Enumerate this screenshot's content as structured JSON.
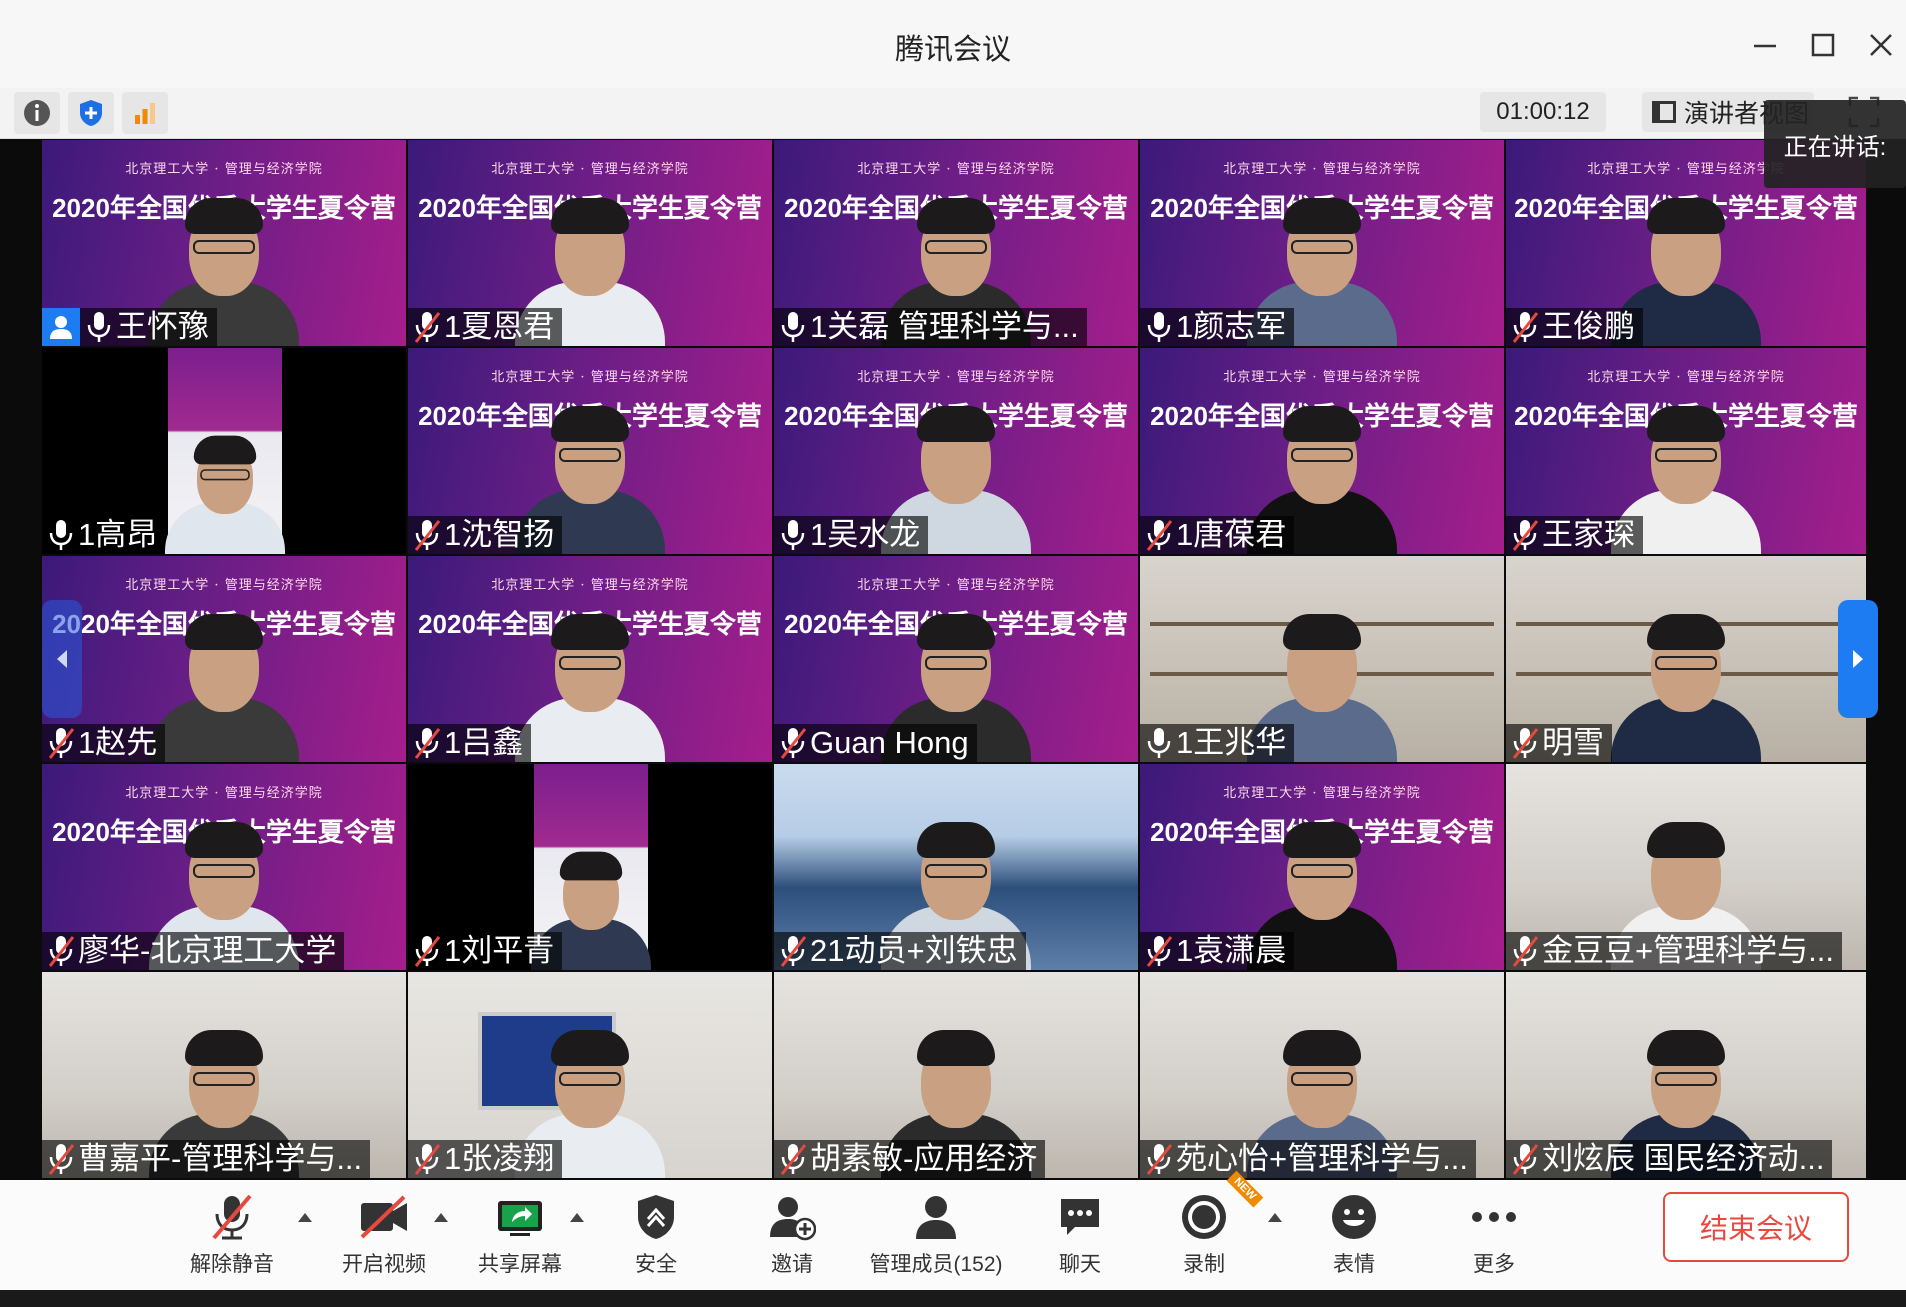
{
  "window": {
    "title": "腾讯会议"
  },
  "toolbar": {
    "timer": "01:00:12",
    "speaker_view": "演讲者视图",
    "speaking_label": "正在讲话:"
  },
  "participants": [
    {
      "name": "王怀豫",
      "mic": "on",
      "bg": "banner",
      "host": true
    },
    {
      "name": "1夏恩君",
      "mic": "muted",
      "bg": "banner"
    },
    {
      "name": "1关磊 管理科学与...",
      "mic": "on",
      "bg": "banner"
    },
    {
      "name": "1颜志军",
      "mic": "on",
      "bg": "banner"
    },
    {
      "name": "王俊鹏",
      "mic": "muted",
      "bg": "banner"
    },
    {
      "name": "1高昂",
      "mic": "on",
      "bg": "narrow"
    },
    {
      "name": "1沈智扬",
      "mic": "muted",
      "bg": "banner"
    },
    {
      "name": "1吴水龙",
      "mic": "on",
      "bg": "banner"
    },
    {
      "name": "1唐葆君",
      "mic": "muted",
      "bg": "banner"
    },
    {
      "name": "王家琛",
      "mic": "muted",
      "bg": "banner"
    },
    {
      "name": "1赵先",
      "mic": "muted",
      "bg": "banner"
    },
    {
      "name": "1吕鑫",
      "mic": "muted",
      "bg": "banner"
    },
    {
      "name": "Guan Hong",
      "mic": "muted",
      "bg": "banner"
    },
    {
      "name": "1王兆华",
      "mic": "on",
      "bg": "shelf"
    },
    {
      "name": "明雪",
      "mic": "muted",
      "bg": "shelf"
    },
    {
      "name": "廖华-北京理工大学",
      "mic": "muted",
      "bg": "banner"
    },
    {
      "name": "1刘平青",
      "mic": "muted",
      "bg": "narrow"
    },
    {
      "name": "21动员+刘铁忠",
      "mic": "muted",
      "bg": "sky"
    },
    {
      "name": "1袁潇晨",
      "mic": "muted",
      "bg": "banner"
    },
    {
      "name": "金豆豆+管理科学与...",
      "mic": "muted",
      "bg": "room"
    },
    {
      "name": "曹嘉平-管理科学与...",
      "mic": "muted",
      "bg": "room"
    },
    {
      "name": "1张凌翔",
      "mic": "muted",
      "bg": "office"
    },
    {
      "name": "胡素敏-应用经济",
      "mic": "muted",
      "bg": "room"
    },
    {
      "name": "苑心怡+管理科学与...",
      "mic": "muted",
      "bg": "room"
    },
    {
      "name": "刘炫辰 国民经济动...",
      "mic": "muted",
      "bg": "room"
    }
  ],
  "banner": {
    "university": "北京理工大学 · 管理与经济学院",
    "camp": "2020年全国优秀大学生夏令营"
  },
  "bottom": {
    "unmute": "解除静音",
    "video": "开启视频",
    "share": "共享屏幕",
    "security": "安全",
    "invite": "邀请",
    "members": "管理成员(152)",
    "chat": "聊天",
    "record": "录制",
    "record_badge": "NEW",
    "emoji": "表情",
    "more": "更多",
    "end": "结束会议"
  },
  "colors": {
    "accent": "#1e7cf2",
    "end": "#e8493f",
    "banner_a": "#3b1a7a",
    "banner_b": "#a51e8c"
  }
}
